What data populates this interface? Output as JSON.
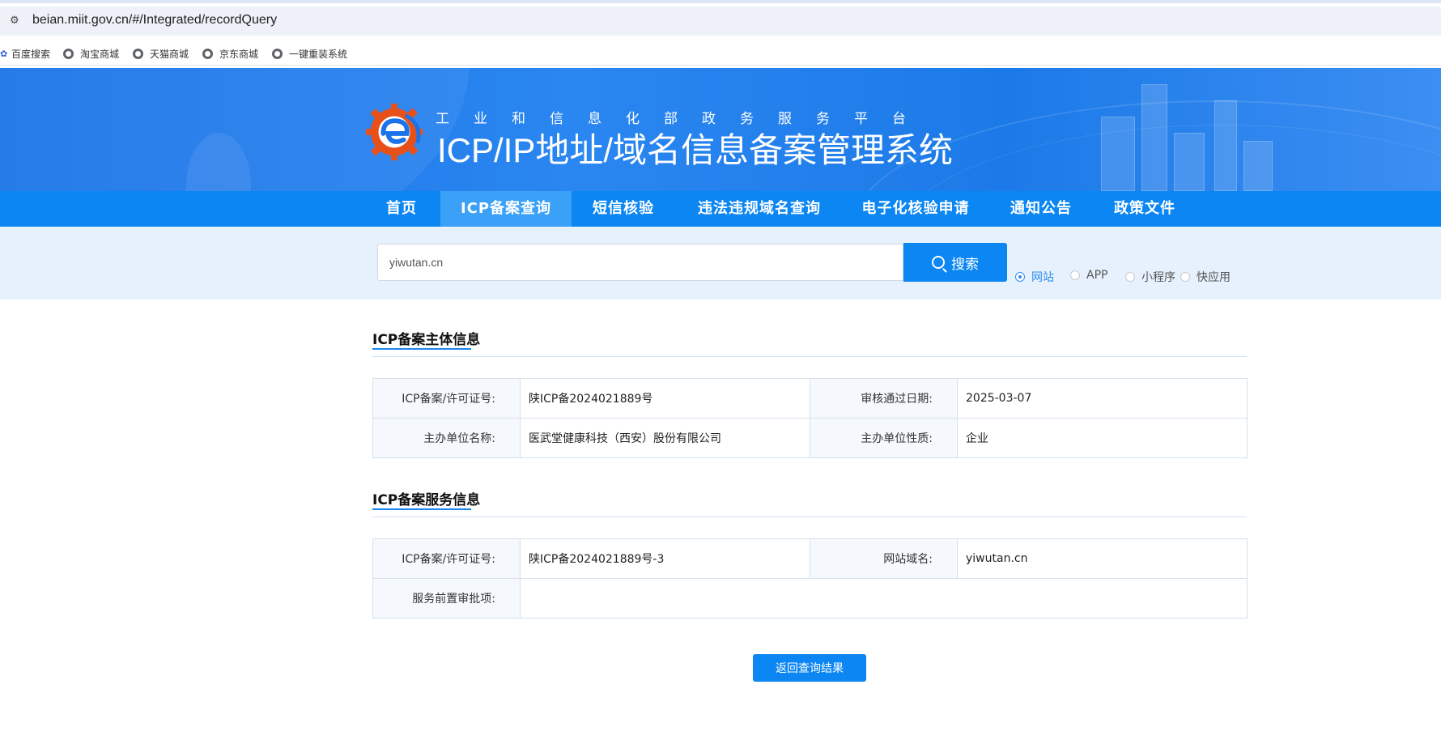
{
  "browser": {
    "url": "beian.miit.gov.cn/#/Integrated/recordQuery",
    "bookmarks": [
      "百度搜索",
      "淘宝商城",
      "天猫商城",
      "京东商城",
      "一键重装系统"
    ]
  },
  "header": {
    "subtitle": "工业和信息化部政务服务平台",
    "title": "ICP/IP地址/域名信息备案管理系统"
  },
  "nav": {
    "items": [
      "首页",
      "ICP备案查询",
      "短信核验",
      "违法违规域名查询",
      "电子化核验申请",
      "通知公告",
      "政策文件"
    ],
    "active_index": 1
  },
  "search": {
    "value": "yiwutan.cn",
    "button_label": "搜索",
    "types": [
      "网站",
      "APP",
      "小程序",
      "快应用"
    ],
    "selected_type": "网站"
  },
  "subject_info": {
    "title": "ICP备案主体信息",
    "rows": [
      {
        "k1": "ICP备案/许可证号:",
        "v1": "陕ICP备2024021889号",
        "k2": "审核通过日期:",
        "v2": "2025-03-07"
      },
      {
        "k1": "主办单位名称:",
        "v1": "医武堂健康科技（西安）股份有限公司",
        "k2": "主办单位性质:",
        "v2": "企业"
      }
    ]
  },
  "service_info": {
    "title": "ICP备案服务信息",
    "rows": [
      {
        "k1": "ICP备案/许可证号:",
        "v1": "陕ICP备2024021889号-3",
        "k2": "网站域名:",
        "v2": "yiwutan.cn"
      },
      {
        "k1": "服务前置审批项:",
        "v1": ""
      }
    ]
  },
  "back_button": "返回查询结果",
  "colors": {
    "primary": "#0b86f2",
    "nav_active": "#3aa0f8",
    "search_band": "#e7f1fd"
  }
}
